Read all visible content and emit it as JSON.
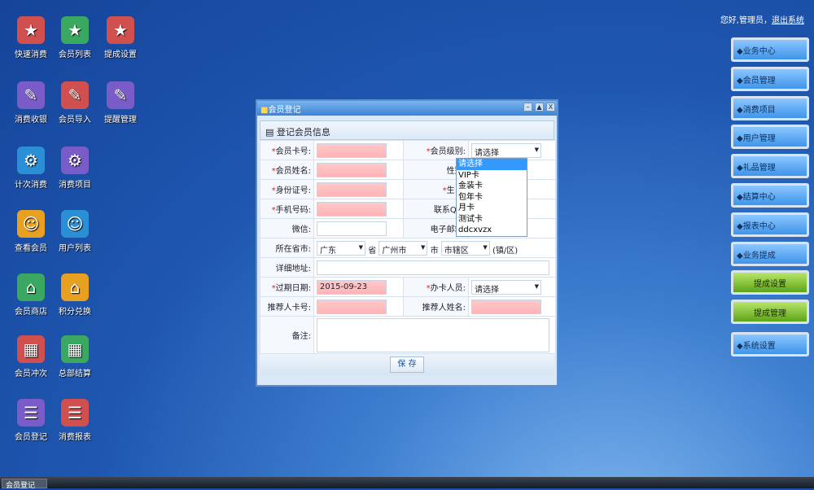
{
  "desktop": {
    "col1": [
      "快速消费",
      "消费收银",
      "计次消费",
      "查看会员",
      "会员商店",
      "会员冲次",
      "会员登记"
    ],
    "col2": [
      "会员列表",
      "会员导入",
      "消费项目",
      "用户列表",
      "积分兑换",
      "总部结算",
      "消费报表"
    ],
    "col3": [
      "提成设置",
      "提醒管理"
    ]
  },
  "header": {
    "greeting": "您好,管理员，",
    "logout": "退出系统"
  },
  "nav": [
    "◆业务中心",
    "◆会员管理",
    "◆消费项目",
    "◆用户管理",
    "◆礼品管理",
    "◆结算中心",
    "◆报表中心",
    "◆业务提成",
    "提成设置",
    "提成管理",
    "◆系统设置"
  ],
  "dialog": {
    "title": "会员登记",
    "section": "登记会员信息",
    "labels": {
      "card": "会员卡号:",
      "level": "会员级别:",
      "name": "会员姓名:",
      "gender": "性别:",
      "id": "身份证号:",
      "birthday": "生日:",
      "phone": "手机号码:",
      "qq": "联系QQ:",
      "wechat": "微信:",
      "email": "电子邮箱:",
      "region": "所在省市:",
      "address": "详细地址:",
      "expire": "过期日期:",
      "handler": "办卡人员:",
      "ref_card": "推荐人卡号:",
      "ref_name": "推荐人姓名:",
      "remark": "备注:"
    },
    "req": "*",
    "level_value": "请选择",
    "level_options": [
      "请选择",
      "VIP卡",
      "金装卡",
      "包年卡",
      "月卡",
      "测试卡",
      "ddcxvzx"
    ],
    "province": "广东",
    "province_suffix": "省",
    "city": "广州市",
    "city_suffix": "市",
    "district": "市辖区",
    "district_suffix": "(镇/区)",
    "expire_value": "2015-09-23",
    "handler_value": "请选择",
    "save": "保 存"
  },
  "taskbar": {
    "task": "会员登记"
  }
}
